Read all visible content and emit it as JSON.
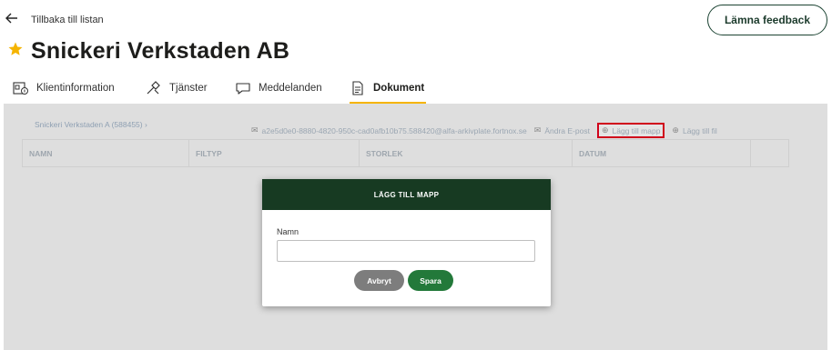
{
  "header": {
    "back_label": "Tillbaka till listan",
    "feedback_label": "Lämna feedback",
    "title": "Snickeri Verkstaden AB"
  },
  "tabs": [
    {
      "label": "Klientinformation",
      "icon": "client-info-icon"
    },
    {
      "label": "Tjänster",
      "icon": "tools-icon"
    },
    {
      "label": "Meddelanden",
      "icon": "chat-bubble-icon"
    },
    {
      "label": "Dokument",
      "icon": "document-icon",
      "active": true
    }
  ],
  "documents": {
    "breadcrumb": "Snickeri Verkstaden A (588455)  ›",
    "email": "a2e5d0e0-8880-4820-950c-cad0afb10b75.588420@alfa-arkivplate.fortnox.se",
    "change_email_label": "Ändra E-post",
    "add_folder_label": "Lägg till mapp",
    "add_file_label": "Lägg till fil",
    "columns": [
      "NAMN",
      "FILTYP",
      "STORLEK",
      "DATUM",
      ""
    ]
  },
  "modal": {
    "title": "LÄGG TILL MAPP",
    "field_label": "Namn",
    "field_value": "",
    "cancel_label": "Avbryt",
    "save_label": "Spara"
  },
  "colors": {
    "accent_yellow": "#f5b400",
    "modal_header": "#173a22",
    "save_button": "#23793a",
    "cancel_button": "#7d7d7d",
    "highlight_border": "#d0021b"
  }
}
